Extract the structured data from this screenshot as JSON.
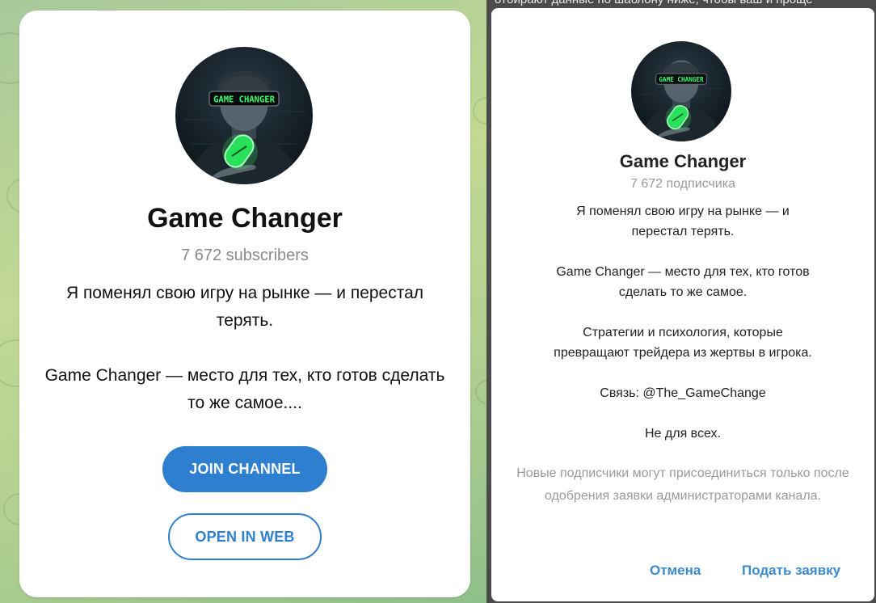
{
  "colors": {
    "accent": "#2f7fd0",
    "dialog_link": "#3a8bd1",
    "neon_green": "#39ff6a",
    "muted_text": "#8a8a8a"
  },
  "left_card": {
    "avatar_overlay_text": "GAME CHANGER",
    "title": "Game Changer",
    "subscribers": "7 672 subscribers",
    "description": "Я поменял свою игру на рынке — и перестал терять.\n\nGame Changer — место для тех, кто готов сделать то же самое....",
    "join_button": "JOIN CHANNEL",
    "web_button": "OPEN IN WEB"
  },
  "right_dialog": {
    "behind_text": "отбирают данные по шаблону ниже, чтобы ваш и проще",
    "avatar_overlay_text": "GAME CHANGER",
    "title": "Game Changer",
    "subscribers": "7 672 подписчика",
    "description": "Я поменял свою игру на рынке — и\nперестал терять.\n\nGame Changer — место для тех, кто готов\nсделать то же самое.\n\nСтратегии и психология, которые\nпревращают трейдера из жертвы в игрока.\n\nСвязь: @The_GameChange\n\nНе для всех.",
    "approval_note": "Новые подписчики могут присоединиться только после одобрения заявки администраторами канала.",
    "cancel_button": "Отмена",
    "submit_button": "Подать заявку"
  }
}
